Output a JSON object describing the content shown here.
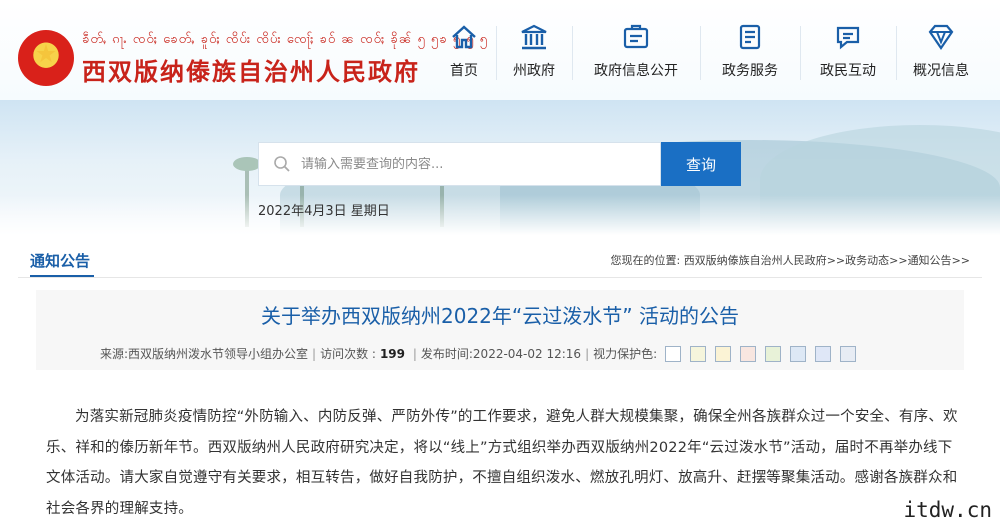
{
  "header": {
    "script_line": "ၶဵတ်ႇ ၵႃႉ ၸဝ်ႈ ၶေတ်ႇ ၶူဝ်ႈ ၸိပ်း ၸိပ်း ၸေႃ်ႈ ၶဝ် ၼ ၸဝ်ႈ ၶိုၼ် ၅ ၅ၶ ၅ ၅ ၅",
    "site_title": "西双版纳傣族自治州人民政府"
  },
  "nav": [
    {
      "label": "首页",
      "icon": "home-icon"
    },
    {
      "label": "州政府",
      "icon": "government-building-icon"
    },
    {
      "label": "政府信息公开",
      "icon": "info-disclosure-icon"
    },
    {
      "label": "政务服务",
      "icon": "service-document-icon"
    },
    {
      "label": "政民互动",
      "icon": "chat-bubble-icon"
    },
    {
      "label": "概况信息",
      "icon": "diamond-overview-icon"
    }
  ],
  "search": {
    "placeholder": "请输入需要查询的内容...",
    "button_label": "查询"
  },
  "date": "2022年4月3日 星期日",
  "section": {
    "title": "通知公告",
    "breadcrumb_prefix": "您现在的位置:",
    "breadcrumb_items": [
      "西双版纳傣族自治州人民政府",
      "政务动态",
      "通知公告"
    ],
    "breadcrumb_sep": ">>"
  },
  "article": {
    "title": "关于举办西双版纳州2022年“云过泼水节” 活动的公告",
    "source": "来源:西双版纳州泼水节领导小组办公室",
    "views_label": "访问次数 :",
    "views": "199",
    "publish_time": "发布时间:2022-04-02 12:16",
    "eye_care_label": "视力保护色:",
    "body": "为落实新冠肺炎疫情防控“外防输入、内防反弹、严防外传”的工作要求，避免人群大规模集聚，确保全州各族群众过一个安全、有序、欢乐、祥和的傣历新年节。西双版纳州人民政府研究决定，将以“线上”方式组织举办西双版纳州2022年“云过泼水节”活动，届时不再举办线下文体活动。请大家自觉遵守有关要求，相互转告，做好自我防护，不擅自组织泼水、燃放孔明灯、放高升、赶摆等聚集活动。感谢各族群众和社会各界的理解支持。"
  },
  "eye_care_colors": [
    "#ffffff",
    "#f5f5dc",
    "#fbf3d5",
    "#f8e6e0",
    "#e8f2d8",
    "#dde8f5",
    "#dfe7f7",
    "#e7ecf4"
  ],
  "watermark": "itdw.cn",
  "colors": {
    "brand_red": "#c8231a",
    "link_blue": "#1a5fa8",
    "button_blue": "#1a6fc4"
  }
}
